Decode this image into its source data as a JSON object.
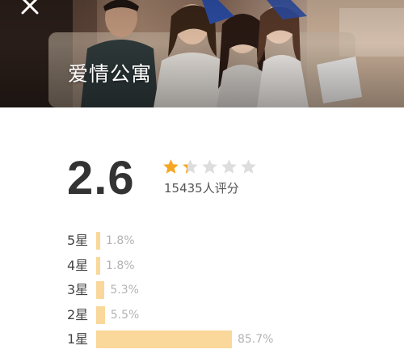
{
  "header": {
    "title": "爱情公寓",
    "close_icon": "close-icon"
  },
  "rating": {
    "score": "2.6",
    "stars_value": 1.3,
    "stars_max": 5,
    "count_text": "15435人评分",
    "star_color": "#f5a623",
    "star_empty_color": "#dddddd"
  },
  "distribution": [
    {
      "label": "5星",
      "percent": "1.8%",
      "value": 1.8
    },
    {
      "label": "4星",
      "percent": "1.8%",
      "value": 1.8
    },
    {
      "label": "3星",
      "percent": "5.3%",
      "value": 5.3
    },
    {
      "label": "2星",
      "percent": "5.5%",
      "value": 5.5
    },
    {
      "label": "1星",
      "percent": "85.7%",
      "value": 85.7
    }
  ],
  "colors": {
    "bar": "#fad79a",
    "percent_text": "#b3b3b3",
    "score_text": "#333333"
  }
}
